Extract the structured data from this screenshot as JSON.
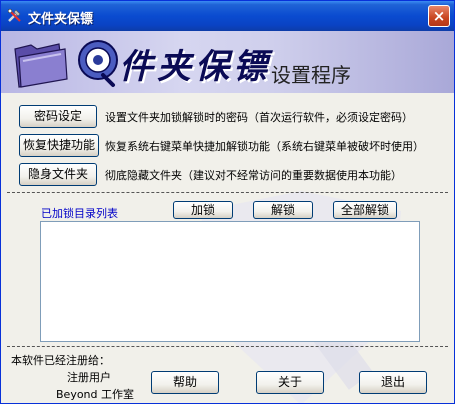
{
  "window": {
    "title": "文件夹保镖",
    "close_label": "×"
  },
  "banner": {
    "title": "件夹保镖",
    "subtitle": "设置程序"
  },
  "actions": [
    {
      "button": "密码设定",
      "description": "设置文件夹加锁解锁时的密码（首次运行软件，必须设定密码）"
    },
    {
      "button": "恢复快捷功能",
      "description": "恢复系统右键菜单快捷加解锁功能（系统右键菜单被破坏时使用）"
    },
    {
      "button": "隐身文件夹",
      "description": "彻底隐藏文件夹（建议对不经常访问的重要数据使用本功能）"
    }
  ],
  "locked_list": {
    "label": "已加锁目录列表",
    "lock_button": "加锁",
    "unlock_button": "解锁",
    "unlock_all_button": "全部解锁",
    "items": []
  },
  "footer": {
    "registered_to_label": "本软件已经注册给：",
    "user_label": "注册用户",
    "studio": "Beyond 工作室",
    "help_button": "帮助",
    "about_button": "关于",
    "exit_button": "退出"
  }
}
